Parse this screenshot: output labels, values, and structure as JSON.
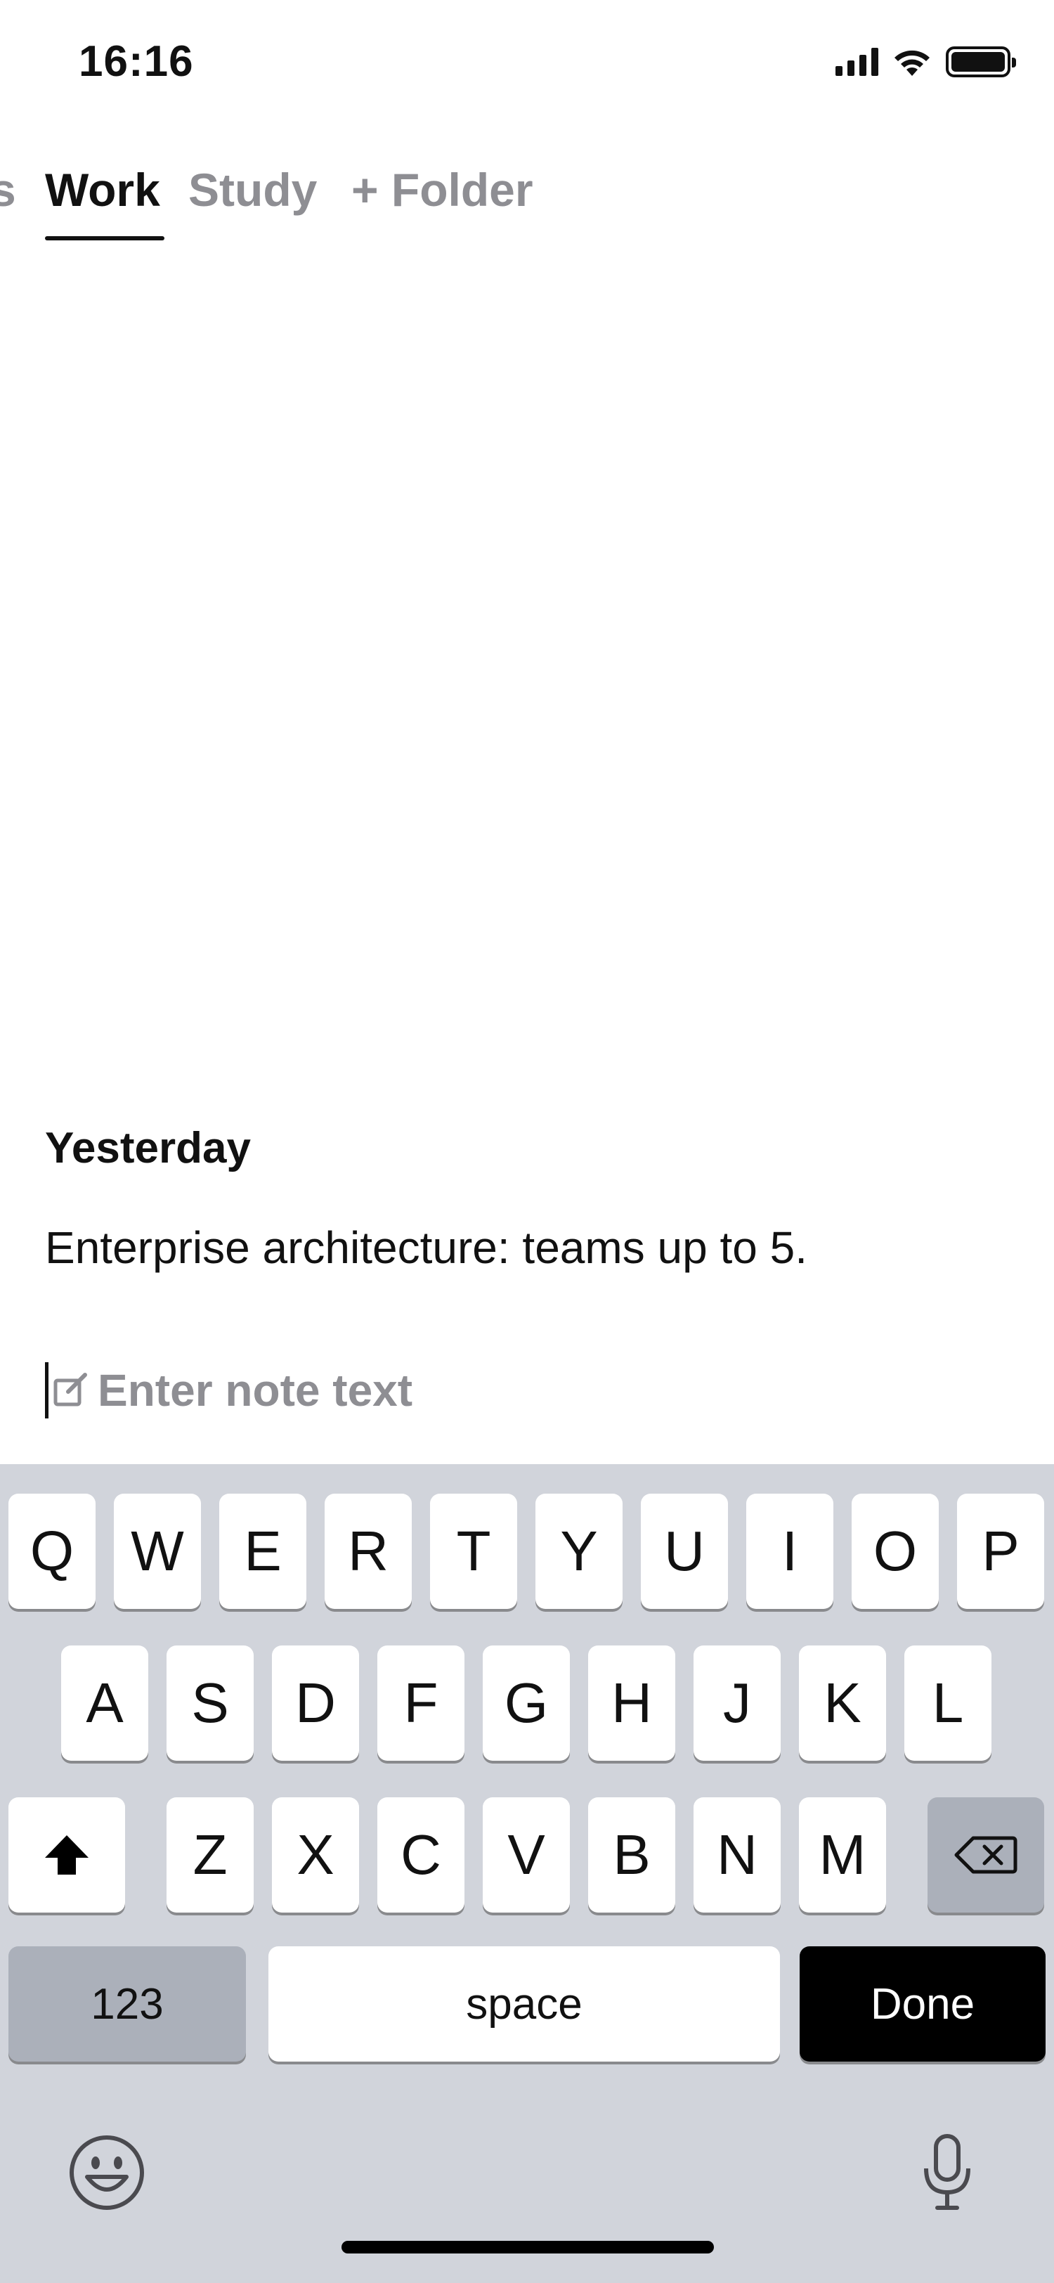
{
  "status_bar": {
    "time": "16:16"
  },
  "folders": {
    "tabs": [
      {
        "label": "s"
      },
      {
        "label": "Work"
      },
      {
        "label": "Study"
      },
      {
        "label": "+ Folder"
      }
    ],
    "active": "Work"
  },
  "notes": {
    "section_header": "Yesterday",
    "items": [
      "Enterprise architecture: teams up to 5."
    ],
    "input_placeholder": "Enter note text"
  },
  "keyboard": {
    "row1": [
      "Q",
      "W",
      "E",
      "R",
      "T",
      "Y",
      "U",
      "I",
      "O",
      "P"
    ],
    "row2": [
      "A",
      "S",
      "D",
      "F",
      "G",
      "H",
      "J",
      "K",
      "L"
    ],
    "row3": [
      "Z",
      "X",
      "C",
      "V",
      "B",
      "N",
      "M"
    ],
    "numbers_label": "123",
    "space_label": "space",
    "done_label": "Done",
    "icons": [
      "shift-icon",
      "backspace-icon",
      "emoji-icon",
      "microphone-icon"
    ]
  }
}
